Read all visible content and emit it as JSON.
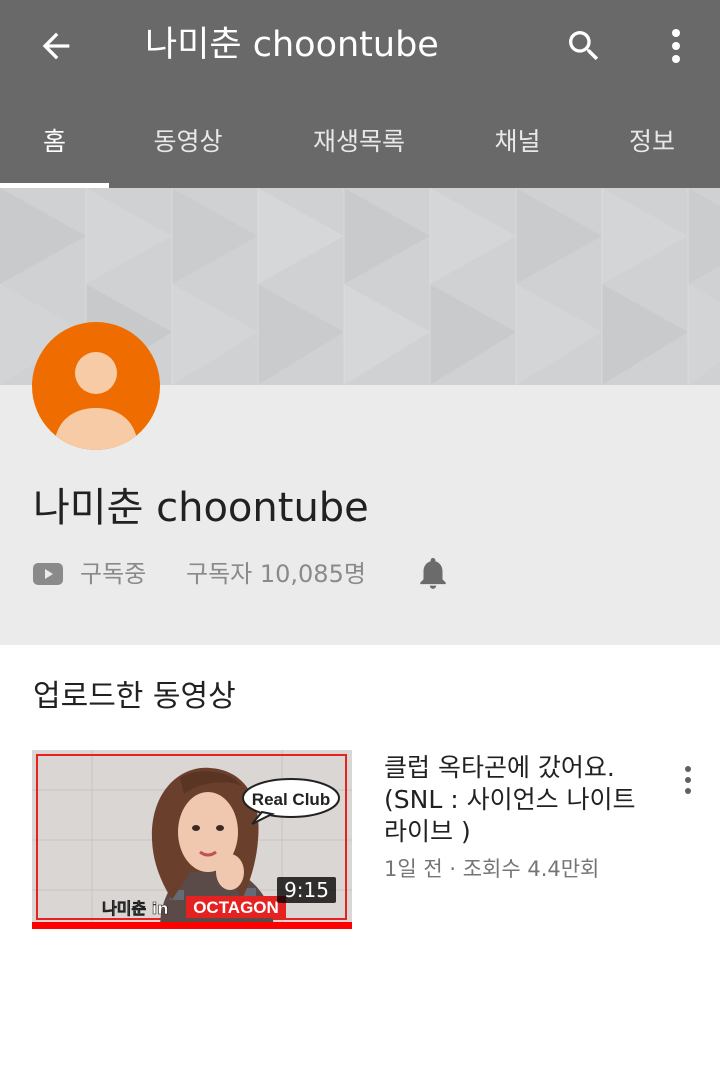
{
  "appbar": {
    "title": "나미춘 choontube",
    "back_icon": "arrow-back-icon",
    "search_icon": "search-icon",
    "more_icon": "more-vert-icon",
    "background_color": "#696969"
  },
  "tabs": [
    {
      "label": "홈",
      "active": true
    },
    {
      "label": "동영상",
      "active": false
    },
    {
      "label": "재생목록",
      "active": false
    },
    {
      "label": "채널",
      "active": false
    },
    {
      "label": "정보",
      "active": false
    }
  ],
  "channel": {
    "name": "나미춘 choontube",
    "avatar_color": "#ef6c00",
    "subscribe_state": "구독중",
    "subscriber_count": "구독자 10,085명",
    "bell_icon": "bell-icon"
  },
  "uploads": {
    "section_title": "업로드한 동영상",
    "videos": [
      {
        "title": "클럽 옥타곤에 갔어요. (SNL : 사이언스 나이트 라이브 )",
        "meta": "1일 전 · 조회수 4.4만회",
        "duration": "9:15",
        "thumbnail_text": {
          "bubble": "Real Club",
          "caption_left": "나미춘 in",
          "caption_right": "OCTAGON"
        },
        "progress_fraction": 1.0
      }
    ]
  }
}
